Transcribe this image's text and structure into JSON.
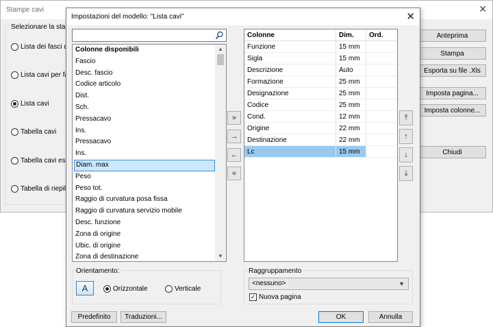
{
  "background_window": {
    "title": "Stampe cavi",
    "close_glyph": "✕",
    "group_label": "Selezionare la stam",
    "radios": [
      {
        "label": "Lista dei fasci di",
        "checked": false
      },
      {
        "label": "Lista cavi per fas",
        "checked": false
      },
      {
        "label": "Lista cavi",
        "checked": true
      },
      {
        "label": "Tabella cavi",
        "checked": false
      },
      {
        "label": "Tabella cavi este",
        "checked": false
      },
      {
        "label": "Tabella di riepilo",
        "checked": false
      }
    ],
    "buttons": [
      "Anteprima",
      "Stampa",
      "Esporta su file .Xls",
      "Imposta pagina...",
      "Imposta colonne...",
      "Chiudi"
    ]
  },
  "dialog": {
    "title": "Impostazioni del modello: \"Lista cavi\"",
    "close_glyph": "✕",
    "search": {
      "value": "",
      "icon": "search-icon"
    },
    "available_header": "Colonne disponibili",
    "available_items": [
      {
        "label": "Fascio",
        "selected": false
      },
      {
        "label": "Desc. fascio",
        "selected": false
      },
      {
        "label": "Codice articolo",
        "selected": false
      },
      {
        "label": "Dist.",
        "selected": false
      },
      {
        "label": "Sch.",
        "selected": false
      },
      {
        "label": "Pressacavo",
        "selected": false
      },
      {
        "label": "Ins.",
        "selected": false
      },
      {
        "label": "Pressacavo",
        "selected": false
      },
      {
        "label": "Ins.",
        "selected": false
      },
      {
        "label": "Diam. max",
        "selected": true
      },
      {
        "label": "Peso",
        "selected": false
      },
      {
        "label": "Peso tot.",
        "selected": false
      },
      {
        "label": "Raggio di curvatura posa fissa",
        "selected": false
      },
      {
        "label": "Raggio di curvatura servizio mobile",
        "selected": false
      },
      {
        "label": "Desc. funzione",
        "selected": false
      },
      {
        "label": "Zona di origine",
        "selected": false
      },
      {
        "label": "Ubic. di origine",
        "selected": false
      },
      {
        "label": "Zona di destinazione",
        "selected": false
      }
    ],
    "move_buttons": [
      {
        "glyph": "»",
        "name": "add-all-button"
      },
      {
        "glyph": "→",
        "name": "add-button"
      },
      {
        "glyph": "←",
        "name": "remove-button"
      },
      {
        "glyph": "«",
        "name": "remove-all-button"
      }
    ],
    "table_headers": [
      "Colonne",
      "Dim.",
      "Ord."
    ],
    "table_rows": [
      {
        "col": "Funzione",
        "dim": "15 mm",
        "ord": "",
        "selected": false
      },
      {
        "col": "Sigla",
        "dim": "15 mm",
        "ord": "",
        "selected": false
      },
      {
        "col": "Descrizione",
        "dim": "Auto",
        "ord": "",
        "selected": false
      },
      {
        "col": "Formazione",
        "dim": "25 mm",
        "ord": "",
        "selected": false
      },
      {
        "col": "Designazione",
        "dim": "25 mm",
        "ord": "",
        "selected": false
      },
      {
        "col": "Codice",
        "dim": "25 mm",
        "ord": "",
        "selected": false
      },
      {
        "col": "Cond.",
        "dim": "12 mm",
        "ord": "",
        "selected": false
      },
      {
        "col": "Origine",
        "dim": "22 mm",
        "ord": "",
        "selected": false
      },
      {
        "col": "Destinazione",
        "dim": "22 mm",
        "ord": "",
        "selected": false
      },
      {
        "col": "Lc",
        "dim": "15 mm",
        "ord": "",
        "selected": true
      }
    ],
    "order_buttons": [
      {
        "glyph": "⤒",
        "name": "move-top-button"
      },
      {
        "glyph": "↑",
        "name": "move-up-button"
      },
      {
        "glyph": "↓",
        "name": "move-down-button"
      },
      {
        "glyph": "⤓",
        "name": "move-bottom-button"
      }
    ],
    "orientation": {
      "label": "Orientamento:",
      "icon_letter": "A",
      "options": [
        {
          "label": "Orizzontale",
          "checked": true
        },
        {
          "label": "Verticale",
          "checked": false
        }
      ]
    },
    "grouping": {
      "label": "Raggruppamento",
      "selected": "<nessuno>",
      "new_page_label": "Nuova pagina",
      "new_page_checked": true
    },
    "footer_buttons": {
      "defaults": "Predefinito",
      "translations": "Traduzioni...",
      "ok": "OK",
      "cancel": "Annulla"
    }
  }
}
